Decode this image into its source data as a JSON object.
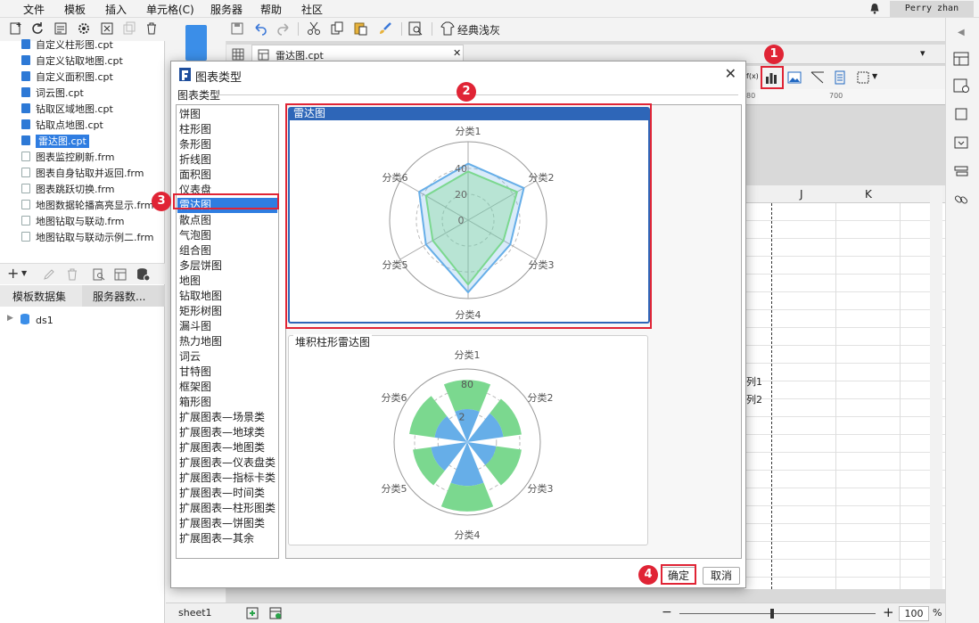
{
  "menu": [
    "文件",
    "模板",
    "插入",
    "单元格(C)",
    "服务器",
    "帮助",
    "社区"
  ],
  "user": "Perry zhan",
  "toolbar": {
    "theme_label": "经典浅灰"
  },
  "doc_tab": "雷达图.cpt",
  "files": [
    {
      "name": "自定义柱形图.cpt",
      "type": "cpt"
    },
    {
      "name": "自定义钻取地图.cpt",
      "type": "cpt"
    },
    {
      "name": "自定义面积图.cpt",
      "type": "cpt"
    },
    {
      "name": "词云图.cpt",
      "type": "cpt"
    },
    {
      "name": "钻取区域地图.cpt",
      "type": "cpt"
    },
    {
      "name": "钻取点地图.cpt",
      "type": "cpt"
    },
    {
      "name": "雷达图.cpt",
      "type": "cpt",
      "selected": true
    },
    {
      "name": "图表监控刷新.frm",
      "type": "frm"
    },
    {
      "name": "图表自身钻取并返回.frm",
      "type": "frm"
    },
    {
      "name": "图表跳跃切换.frm",
      "type": "frm"
    },
    {
      "name": "地图数据轮播高亮显示.frm",
      "type": "frm"
    },
    {
      "name": "地图钻取与联动.frm",
      "type": "frm"
    },
    {
      "name": "地图钻取与联动示例二.frm",
      "type": "frm"
    }
  ],
  "left_tabs": [
    "模板数据集",
    "服务器数..."
  ],
  "datasets": [
    "ds1"
  ],
  "sheet": {
    "columns": [
      "J",
      "K"
    ],
    "ruler_mark": "700",
    "ruler_mark2": "80",
    "series_labels": [
      "列1",
      "列2"
    ]
  },
  "status": {
    "sheet_tab": "sheet1",
    "zoom": "100",
    "zoom_unit": "%"
  },
  "dialog": {
    "title": "图表类型",
    "section_label": "图表类型",
    "chart_types": [
      "饼图",
      "柱形图",
      "条形图",
      "折线图",
      "面积图",
      "仪表盘",
      "雷达图",
      "散点图",
      "气泡图",
      "组合图",
      "多层饼图",
      "地图",
      "钻取地图",
      "矩形树图",
      "漏斗图",
      "热力地图",
      "词云",
      "甘特图",
      "框架图",
      "箱形图",
      "扩展图表—场景类",
      "扩展图表—地球类",
      "扩展图表—地图类",
      "扩展图表—仪表盘类",
      "扩展图表—指标卡类",
      "扩展图表—时间类",
      "扩展图表—柱形图类",
      "扩展图表—饼图类",
      "扩展图表—其余"
    ],
    "selected_type": "雷达图",
    "previews": [
      {
        "label": "雷达图",
        "categories": [
          "分类1",
          "分类2",
          "分类3",
          "分类4",
          "分类5",
          "分类6"
        ],
        "ticks": [
          "40",
          "20",
          "0"
        ]
      },
      {
        "label": "堆积柱形雷达图",
        "categories": [
          "分类1",
          "分类2",
          "分类3",
          "分类4",
          "分类5",
          "分类6"
        ],
        "ticks": [
          "80",
          "2"
        ]
      }
    ],
    "ok_label": "确定",
    "cancel_label": "取消"
  },
  "badges": [
    "1",
    "2",
    "3",
    "4"
  ],
  "colors": {
    "accent": "#2f7de1",
    "highlight": "#e02435",
    "series_blue": "#66aee8",
    "series_green": "#7bd88f"
  }
}
